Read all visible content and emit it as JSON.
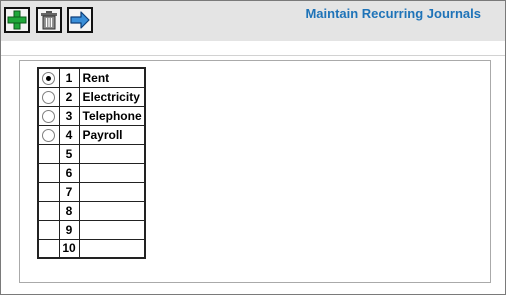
{
  "header": {
    "title": "Maintain Recurring Journals"
  },
  "toolbar": {
    "buttons": [
      {
        "icon": "add-icon"
      },
      {
        "icon": "trash-icon"
      },
      {
        "icon": "arrow-right-icon"
      }
    ]
  },
  "journals": {
    "selected_index": 0,
    "rows": [
      {
        "number": "1",
        "name": "Rent",
        "has_radio": true,
        "selected": true
      },
      {
        "number": "2",
        "name": "Electricity",
        "has_radio": true,
        "selected": false
      },
      {
        "number": "3",
        "name": "Telephone",
        "has_radio": true,
        "selected": false
      },
      {
        "number": "4",
        "name": "Payroll",
        "has_radio": true,
        "selected": false
      },
      {
        "number": "5",
        "name": "",
        "has_radio": false,
        "selected": false
      },
      {
        "number": "6",
        "name": "",
        "has_radio": false,
        "selected": false
      },
      {
        "number": "7",
        "name": "",
        "has_radio": false,
        "selected": false
      },
      {
        "number": "8",
        "name": "",
        "has_radio": false,
        "selected": false
      },
      {
        "number": "9",
        "name": "",
        "has_radio": false,
        "selected": false
      },
      {
        "number": "10",
        "name": "",
        "has_radio": false,
        "selected": false
      }
    ]
  },
  "colors": {
    "title": "#1e73b8",
    "toolbar_bg": "#e4e4e4",
    "add_green": "#1fa83a",
    "arrow_blue": "#3a8fd9"
  }
}
